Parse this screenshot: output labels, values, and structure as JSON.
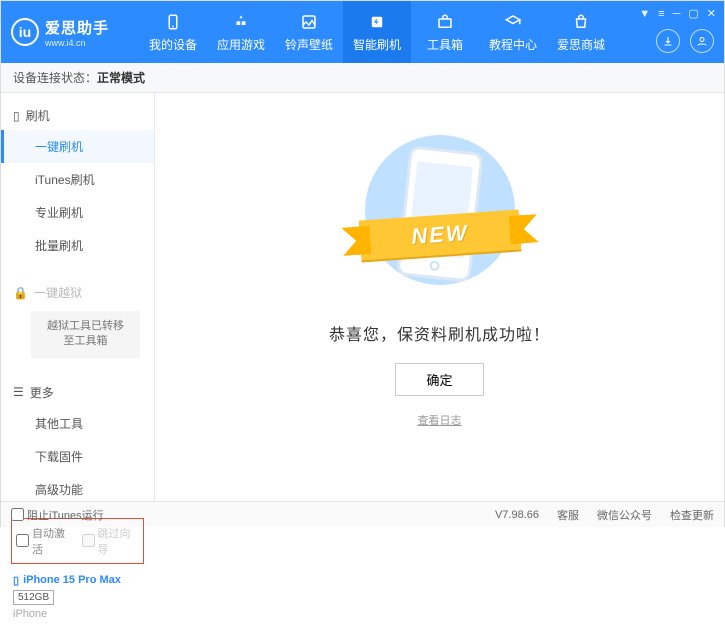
{
  "header": {
    "logo_title": "爱思助手",
    "logo_sub": "www.i4.cn",
    "nav": [
      {
        "label": "我的设备"
      },
      {
        "label": "应用游戏"
      },
      {
        "label": "铃声壁纸"
      },
      {
        "label": "智能刷机"
      },
      {
        "label": "工具箱"
      },
      {
        "label": "教程中心"
      },
      {
        "label": "爱思商城"
      }
    ],
    "active_nav_index": 3
  },
  "status": {
    "label": "设备连接状态：",
    "mode": "正常模式"
  },
  "sidebar": {
    "flash_section": {
      "title": "刷机"
    },
    "flash_items": [
      {
        "label": "一键刷机"
      },
      {
        "label": "iTunes刷机"
      },
      {
        "label": "专业刷机"
      },
      {
        "label": "批量刷机"
      }
    ],
    "active_flash_index": 0,
    "jailbreak_section": {
      "title": "一键越狱"
    },
    "jailbreak_note": "越狱工具已转移至工具箱",
    "more_section": {
      "title": "更多"
    },
    "more_items": [
      {
        "label": "其他工具"
      },
      {
        "label": "下载固件"
      },
      {
        "label": "高级功能"
      }
    ],
    "options": {
      "auto_activate": "自动激活",
      "skip_setup": "跳过向导"
    },
    "device": {
      "name": "iPhone 15 Pro Max",
      "storage": "512GB",
      "type": "iPhone"
    }
  },
  "main": {
    "ribbon": "NEW",
    "success": "恭喜您，保资料刷机成功啦！",
    "ok": "确定",
    "view_log": "查看日志"
  },
  "footer": {
    "block_itunes": "阻止iTunes运行",
    "version": "V7.98.66",
    "links": [
      "客服",
      "微信公众号",
      "检查更新"
    ]
  }
}
